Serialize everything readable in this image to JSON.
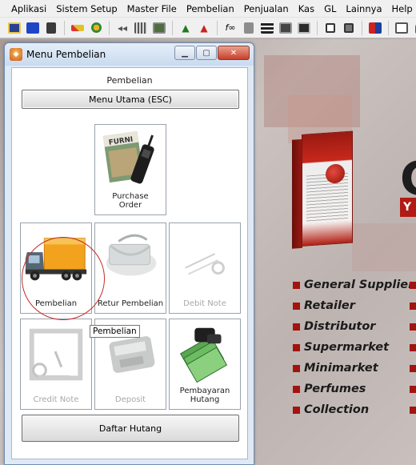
{
  "menubar": {
    "items": [
      {
        "label": "Aplikasi"
      },
      {
        "label": "Sistem Setup"
      },
      {
        "label": "Master File"
      },
      {
        "label": "Pembelian"
      },
      {
        "label": "Penjualan"
      },
      {
        "label": "Kas"
      },
      {
        "label": "GL"
      },
      {
        "label": "Lainnya"
      },
      {
        "label": "Help"
      }
    ]
  },
  "toolbar": {
    "icons": [
      "window-icon",
      "blue-box-icon",
      "document-icon",
      "pen-icon",
      "user-icon",
      "first-record-icon",
      "grid-icon",
      "image-icon",
      "chart-icon",
      "chart-alt-icon",
      "fx-icon",
      "calculator-icon",
      "table-icon",
      "report-icon",
      "form-icon",
      "copy-icon",
      "share-icon",
      "book-icon",
      "export-icon",
      "lock-icon"
    ]
  },
  "window": {
    "title": "Menu Pembelian",
    "panel_title": "Pembelian",
    "main_button": "Menu Utama (ESC)",
    "tiles": [
      {
        "label_1": "Purchase",
        "label_2": "Order",
        "enabled": true
      },
      {
        "label": "Pembelian",
        "enabled": true
      },
      {
        "label": "Retur Pembelian",
        "enabled": true
      },
      {
        "label": "Debit Note",
        "enabled": false
      },
      {
        "label": "Credit Note",
        "enabled": false
      },
      {
        "label": "Deposit",
        "enabled": false
      },
      {
        "label_1": "Pembayaran",
        "label_2": "Hutang",
        "enabled": true
      }
    ],
    "tooltip": "Pembelian",
    "bottom_button": "Daftar Hutang",
    "magazine_text": "FURNI"
  },
  "background": {
    "badge_letter": "Y",
    "bullets": [
      "General Supplier",
      "Retailer",
      "Distributor",
      "Supermarket",
      "Minimarket",
      "Perfumes",
      "Collection"
    ],
    "colors": {
      "bullet": "#a3130f",
      "box_red": "#b21a13"
    }
  }
}
